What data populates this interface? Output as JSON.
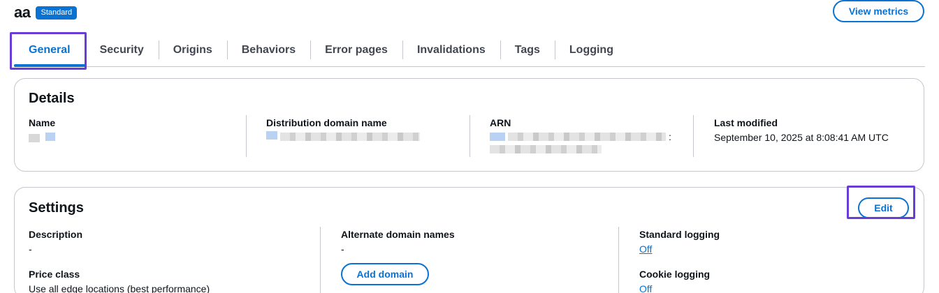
{
  "header": {
    "title": "aa",
    "badge": "Standard",
    "view_metrics_label": "View metrics"
  },
  "tabs": [
    {
      "label": "General",
      "active": true
    },
    {
      "label": "Security"
    },
    {
      "label": "Origins"
    },
    {
      "label": "Behaviors"
    },
    {
      "label": "Error pages"
    },
    {
      "label": "Invalidations"
    },
    {
      "label": "Tags"
    },
    {
      "label": "Logging"
    }
  ],
  "details": {
    "title": "Details",
    "name_label": "Name",
    "domain_label": "Distribution domain name",
    "arn_label": "ARN",
    "arn_suffix": ":",
    "last_modified_label": "Last modified",
    "last_modified_value": "September 10, 2025 at 8:08:41 AM UTC"
  },
  "settings": {
    "title": "Settings",
    "edit_label": "Edit",
    "description_label": "Description",
    "description_value": "-",
    "price_class_label": "Price class",
    "price_class_value": "Use all edge locations (best performance)",
    "alt_domains_label": "Alternate domain names",
    "alt_domains_value": "-",
    "add_domain_label": "Add domain",
    "standard_logging_label": "Standard logging",
    "standard_logging_value": "Off",
    "cookie_logging_label": "Cookie logging",
    "cookie_logging_value": "Off"
  },
  "colors": {
    "accent": "#0972d3",
    "highlight": "#6a3cd6",
    "border": "#c6c6cd"
  }
}
